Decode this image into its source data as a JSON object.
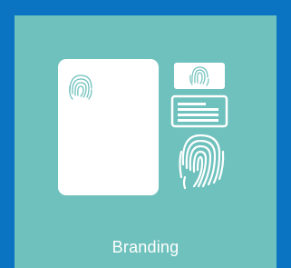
{
  "tile": {
    "label": "Branding",
    "icon": "fingerprint-stationery-icon",
    "colors": {
      "frame": "#0a73c2",
      "card": "#6fc1bd",
      "paper": "#ffffff",
      "print": "#6fc1bd"
    }
  }
}
